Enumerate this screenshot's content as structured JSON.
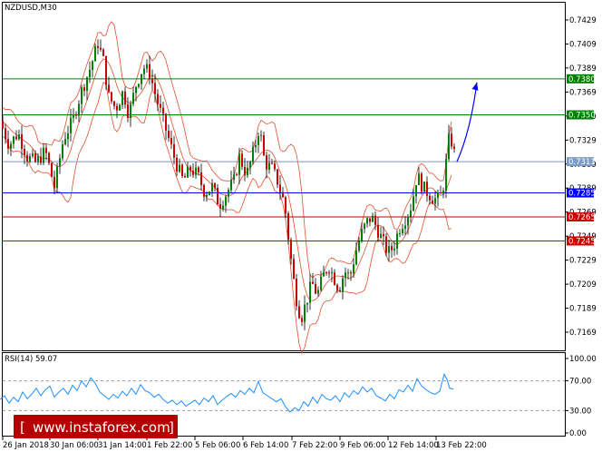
{
  "chart_data": {
    "type": "candlestick",
    "symbol_label": "NZDUSD,M30",
    "y_axis": {
      "ticks": [
        "0.7429",
        "0.7409",
        "0.7389",
        "0.7369",
        "0.7349",
        "0.7329",
        "0.7309",
        "0.7289",
        "0.7269",
        "0.7249",
        "0.7229",
        "0.7209",
        "0.7189",
        "0.7169"
      ],
      "range": [
        0.7165,
        0.7442
      ]
    },
    "x_axis": {
      "ticks": [
        "26 Jan 2018",
        "30 Jan 06:00",
        "31 Jan 14:00",
        "1 Feb 22:00",
        "5 Feb 06:00",
        "6 Feb 14:00",
        "7 Feb 22:00",
        "9 Feb 06:00",
        "12 Feb 14:00",
        "13 Feb 22:00"
      ]
    },
    "levels": [
      {
        "label": "0.7380",
        "value": 0.738,
        "color": "#008000"
      },
      {
        "label": "0.7350",
        "value": 0.735,
        "color": "#008000"
      },
      {
        "label": "0.7311",
        "value": 0.7311,
        "color": "#7b9bc8"
      },
      {
        "label": "0.7285",
        "value": 0.7285,
        "color": "#0000ff"
      },
      {
        "label": "0.7265",
        "value": 0.7265,
        "color": "#cc0000"
      },
      {
        "label": "0.7245",
        "value": 0.7245,
        "color": "#cc0000"
      }
    ],
    "price_path": [
      [
        0,
        0.7345
      ],
      [
        10,
        0.7325
      ],
      [
        20,
        0.7335
      ],
      [
        30,
        0.7315
      ],
      [
        40,
        0.731
      ],
      [
        50,
        0.732
      ],
      [
        60,
        0.729
      ],
      [
        70,
        0.733
      ],
      [
        80,
        0.7345
      ],
      [
        90,
        0.737
      ],
      [
        100,
        0.739
      ],
      [
        108,
        0.741
      ],
      [
        114,
        0.7395
      ],
      [
        120,
        0.7365
      ],
      [
        128,
        0.7355
      ],
      [
        136,
        0.737
      ],
      [
        142,
        0.735
      ],
      [
        150,
        0.7375
      ],
      [
        158,
        0.739
      ],
      [
        165,
        0.7385
      ],
      [
        172,
        0.7365
      ],
      [
        178,
        0.735
      ],
      [
        186,
        0.733
      ],
      [
        194,
        0.731
      ],
      [
        202,
        0.7295
      ],
      [
        210,
        0.7305
      ],
      [
        218,
        0.73
      ],
      [
        226,
        0.7285
      ],
      [
        234,
        0.729
      ],
      [
        242,
        0.7275
      ],
      [
        250,
        0.7285
      ],
      [
        258,
        0.7295
      ],
      [
        264,
        0.7315
      ],
      [
        272,
        0.73
      ],
      [
        280,
        0.732
      ],
      [
        286,
        0.734
      ],
      [
        292,
        0.731
      ],
      [
        300,
        0.7305
      ],
      [
        306,
        0.7295
      ],
      [
        314,
        0.7275
      ],
      [
        320,
        0.7235
      ],
      [
        326,
        0.72
      ],
      [
        332,
        0.718
      ],
      [
        338,
        0.7195
      ],
      [
        344,
        0.721
      ],
      [
        350,
        0.72
      ],
      [
        356,
        0.7215
      ],
      [
        362,
        0.7225
      ],
      [
        368,
        0.7215
      ],
      [
        374,
        0.7205
      ],
      [
        380,
        0.722
      ],
      [
        386,
        0.7215
      ],
      [
        392,
        0.7235
      ],
      [
        398,
        0.725
      ],
      [
        404,
        0.726
      ],
      [
        410,
        0.7265
      ],
      [
        416,
        0.7255
      ],
      [
        422,
        0.7245
      ],
      [
        428,
        0.7235
      ],
      [
        434,
        0.724
      ],
      [
        440,
        0.7255
      ],
      [
        448,
        0.7265
      ],
      [
        454,
        0.7275
      ],
      [
        460,
        0.73
      ],
      [
        466,
        0.729
      ],
      [
        472,
        0.7285
      ],
      [
        478,
        0.728
      ],
      [
        484,
        0.728
      ],
      [
        488,
        0.7285
      ],
      [
        492,
        0.731
      ],
      [
        496,
        0.7335
      ],
      [
        500,
        0.732
      ],
      [
        504,
        0.7312
      ]
    ],
    "forecast_arrow": {
      "from": [
        504,
        0.7311
      ],
      "to": [
        526,
        0.7377
      ],
      "color": "#0000ff"
    },
    "rsi": {
      "label": "RSI(14) 59.07",
      "ticks": [
        "100.00",
        "70.00",
        "30.00",
        "0.00"
      ],
      "levels": [
        70,
        30
      ],
      "series": [
        [
          0,
          45
        ],
        [
          5,
          50
        ],
        [
          10,
          40
        ],
        [
          15,
          48
        ],
        [
          20,
          42
        ],
        [
          25,
          55
        ],
        [
          30,
          46
        ],
        [
          35,
          52
        ],
        [
          40,
          60
        ],
        [
          45,
          50
        ],
        [
          50,
          58
        ],
        [
          55,
          63
        ],
        [
          60,
          48
        ],
        [
          65,
          55
        ],
        [
          70,
          60
        ],
        [
          75,
          52
        ],
        [
          80,
          64
        ],
        [
          85,
          57
        ],
        [
          90,
          70
        ],
        [
          95,
          62
        ],
        [
          100,
          74
        ],
        [
          105,
          67
        ],
        [
          110,
          55
        ],
        [
          115,
          50
        ],
        [
          120,
          45
        ],
        [
          125,
          52
        ],
        [
          130,
          47
        ],
        [
          135,
          56
        ],
        [
          140,
          50
        ],
        [
          145,
          60
        ],
        [
          150,
          52
        ],
        [
          155,
          65
        ],
        [
          160,
          57
        ],
        [
          165,
          54
        ],
        [
          170,
          48
        ],
        [
          175,
          52
        ],
        [
          180,
          45
        ],
        [
          185,
          40
        ],
        [
          190,
          44
        ],
        [
          195,
          38
        ],
        [
          200,
          43
        ],
        [
          205,
          36
        ],
        [
          210,
          40
        ],
        [
          215,
          44
        ],
        [
          220,
          38
        ],
        [
          225,
          47
        ],
        [
          230,
          42
        ],
        [
          235,
          50
        ],
        [
          240,
          38
        ],
        [
          245,
          44
        ],
        [
          250,
          49
        ],
        [
          255,
          53
        ],
        [
          260,
          48
        ],
        [
          265,
          57
        ],
        [
          270,
          52
        ],
        [
          275,
          60
        ],
        [
          280,
          54
        ],
        [
          285,
          69
        ],
        [
          290,
          54
        ],
        [
          295,
          50
        ],
        [
          300,
          46
        ],
        [
          305,
          42
        ],
        [
          310,
          46
        ],
        [
          315,
          35
        ],
        [
          320,
          28
        ],
        [
          325,
          34
        ],
        [
          330,
          30
        ],
        [
          335,
          42
        ],
        [
          340,
          36
        ],
        [
          345,
          48
        ],
        [
          350,
          40
        ],
        [
          355,
          52
        ],
        [
          360,
          46
        ],
        [
          365,
          44
        ],
        [
          370,
          50
        ],
        [
          375,
          42
        ],
        [
          380,
          54
        ],
        [
          385,
          48
        ],
        [
          390,
          57
        ],
        [
          395,
          52
        ],
        [
          400,
          62
        ],
        [
          405,
          55
        ],
        [
          410,
          60
        ],
        [
          415,
          50
        ],
        [
          420,
          47
        ],
        [
          425,
          43
        ],
        [
          430,
          52
        ],
        [
          435,
          46
        ],
        [
          440,
          58
        ],
        [
          445,
          55
        ],
        [
          450,
          64
        ],
        [
          455,
          56
        ],
        [
          460,
          73
        ],
        [
          465,
          63
        ],
        [
          470,
          58
        ],
        [
          475,
          54
        ],
        [
          480,
          52
        ],
        [
          485,
          56
        ],
        [
          490,
          79
        ],
        [
          493,
          72
        ],
        [
          496,
          60
        ],
        [
          500,
          59
        ]
      ]
    }
  },
  "watermark": {
    "text": "www.instaforex.com",
    "bg_color": "#b40000",
    "bracket_left": "[",
    "bracket_right": "]"
  }
}
